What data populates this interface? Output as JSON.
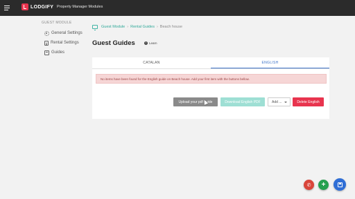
{
  "topbar": {
    "logo_text": "LODGIFY",
    "app_title": "Property Manager Modules"
  },
  "sidebar": {
    "heading": "GUEST MODULE",
    "items": [
      {
        "label": "General Settings",
        "icon": "gear-icon"
      },
      {
        "label": "Rental Settings",
        "icon": "document-icon"
      },
      {
        "label": "Guides",
        "icon": "guide-icon"
      }
    ]
  },
  "breadcrumb": {
    "home_icon": "home-icon",
    "items": [
      "Guest Module",
      "Rental Guides",
      "Beach house"
    ],
    "separator": "›"
  },
  "page": {
    "title": "Guest Guides",
    "learn_label": "Learn",
    "info_glyph": "i"
  },
  "tabs": [
    {
      "label": "CATALAN",
      "active": false
    },
    {
      "label": "ENGLISH",
      "active": true
    }
  ],
  "alert": {
    "message": "No items have been found for the English guide on Beach house. Add your first item with the buttons bellow."
  },
  "actions": {
    "upload_label": "Upload your pdf guide",
    "download_label": "Download English PDF",
    "add_label": "Add ...",
    "delete_label": "Delete English"
  },
  "fabs": {
    "call_glyph": "✆",
    "add_glyph": "+"
  },
  "colors": {
    "topbar": "#2b2b2b",
    "brand": "#e8344e",
    "link": "#2ea898",
    "tab_active": "#3b72c8",
    "alert_bg": "#f6d6d6",
    "delete": "#e8344e",
    "fab_call": "#d9453a",
    "fab_add": "#25a04f",
    "fab_save": "#2f6ed6"
  }
}
